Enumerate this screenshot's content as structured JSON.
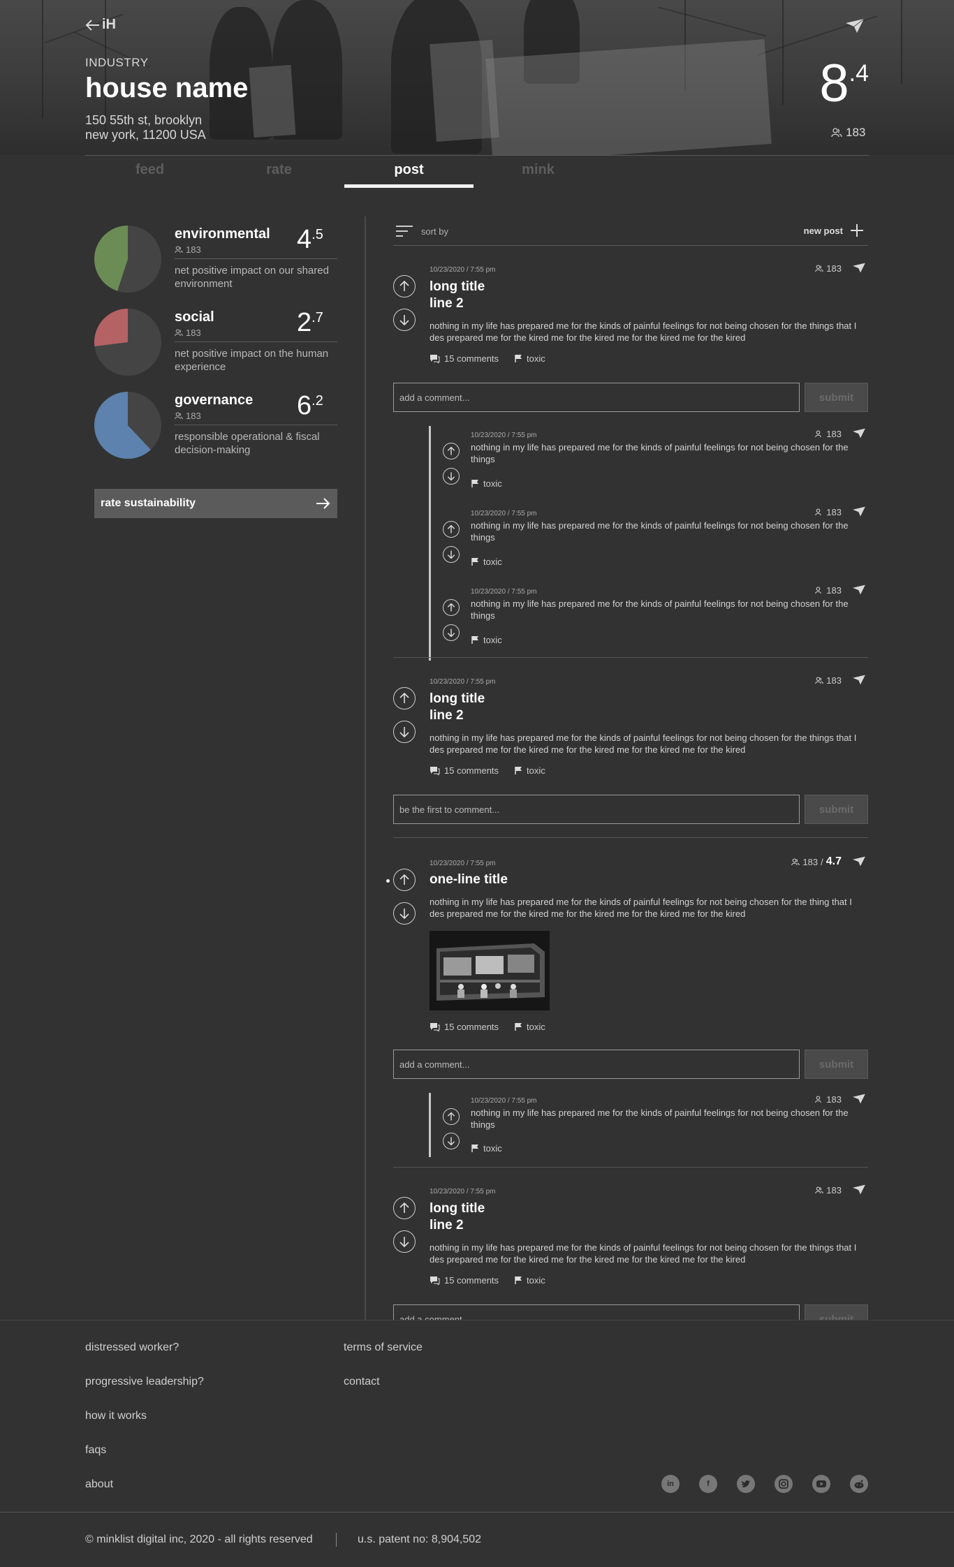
{
  "header": {
    "back_label": "iH",
    "category": "INDUSTRY",
    "house_name": "house name",
    "address_line1": "150 55th st, brooklyn",
    "address_line2": "new york, 11200 USA",
    "overall_score_int": "8",
    "overall_score_dec": ".4",
    "rater_count": "183"
  },
  "tabs": [
    {
      "label": "feed"
    },
    {
      "label": "rate"
    },
    {
      "label": "post",
      "active": true
    },
    {
      "label": "mink"
    }
  ],
  "ratings": [
    {
      "name": "environmental",
      "count": "183",
      "score_int": "4",
      "score_dec": ".5",
      "score": 4.5,
      "color": "#6b8c55",
      "description": "net positive impact on our shared environment"
    },
    {
      "name": "social",
      "count": "183",
      "score_int": "2",
      "score_dec": ".7",
      "score": 2.7,
      "color": "#b56265",
      "description": "net positive impact on the human experience"
    },
    {
      "name": "governance",
      "count": "183",
      "score_int": "6",
      "score_dec": ".2",
      "score": 6.2,
      "color": "#5c82ad",
      "description": "responsible operational & fiscal decision-making"
    }
  ],
  "rate_button_label": "rate sustainability",
  "feed": {
    "sort_label": "sort by",
    "new_post_label": "new post",
    "posts": [
      {
        "date": "10/23/2020 / 7:55 pm",
        "count": "183",
        "title_line1": "long title",
        "title_line2": "line 2",
        "body": "nothing in my life has prepared me for the  kinds of painful feelings for not being chosen for the things that I des prepared me for the kired me for the kired me for the kired me for the kired",
        "comments": "15 comments",
        "flag": "toxic",
        "input_placeholder": "add a comment...",
        "submit": "submit",
        "replies": [
          {
            "date": "10/23/2020 / 7:55 pm",
            "count": "183",
            "body": "nothing in my life has prepared me for the  kinds of painful feelings for not being chosen for the things",
            "flag": "toxic"
          },
          {
            "date": "10/23/2020 / 7:55 pm",
            "count": "183",
            "body": "nothing in my life has prepared me for the  kinds of painful feelings for not being chosen for the things",
            "flag": "toxic"
          },
          {
            "date": "10/23/2020 / 7:55 pm",
            "count": "183",
            "body": "nothing in my life has prepared me for the  kinds of painful feelings for not being chosen for the things",
            "flag": "toxic"
          }
        ]
      },
      {
        "date": "10/23/2020 / 7:55 pm",
        "count": "183",
        "title_line1": "long title",
        "title_line2": "line 2",
        "body": "nothing in my life has prepared me for the  kinds of painful feelings for not being chosen for the things that I des prepared me for the kired me for the kired me for the kired me for the kired",
        "comments": "15 comments",
        "flag": "toxic",
        "input_placeholder": "be the first to comment...",
        "submit": "submit"
      },
      {
        "date": "10/23/2020 / 7:55 pm",
        "count": "183",
        "rating": "4.7",
        "title_line1": "one-line title",
        "body": "nothing in my life has prepared me for the  kinds of painful feelings for not being chosen for the thing that I des prepared me for the kired me for the kired me for the kired me for the kired",
        "comments": "15 comments",
        "flag": "toxic",
        "input_placeholder": "add a comment...",
        "submit": "submit",
        "replies": [
          {
            "date": "10/23/2020 / 7:55 pm",
            "count": "183",
            "body": "nothing in my life has prepared me for the  kinds of painful feelings for not being chosen for the things",
            "flag": "toxic"
          }
        ]
      },
      {
        "date": "10/23/2020 / 7:55 pm",
        "count": "183",
        "title_line1": "long title",
        "title_line2": "line 2",
        "body": "nothing in my life has prepared me for the  kinds of painful feelings for not being chosen for the things that I des prepared me for the kired me for the kired me for the kired me for the kired",
        "comments": "15 comments",
        "flag": "toxic",
        "input_placeholder": "add a comment...",
        "submit": "submit"
      }
    ]
  },
  "footer": {
    "links_col1": [
      "distressed worker?",
      "progressive leadership?",
      "how it works",
      "faqs",
      "about"
    ],
    "links_col2": [
      "terms of service",
      "contact"
    ],
    "social_icons": [
      "linkedin-icon",
      "facebook-icon",
      "twitter-icon",
      "instagram-icon",
      "youtube-icon",
      "reddit-icon"
    ],
    "copyright": "©  minklist digital inc, 2020 - all rights reserved",
    "patent": "u.s. patent no: 8,904,502"
  }
}
